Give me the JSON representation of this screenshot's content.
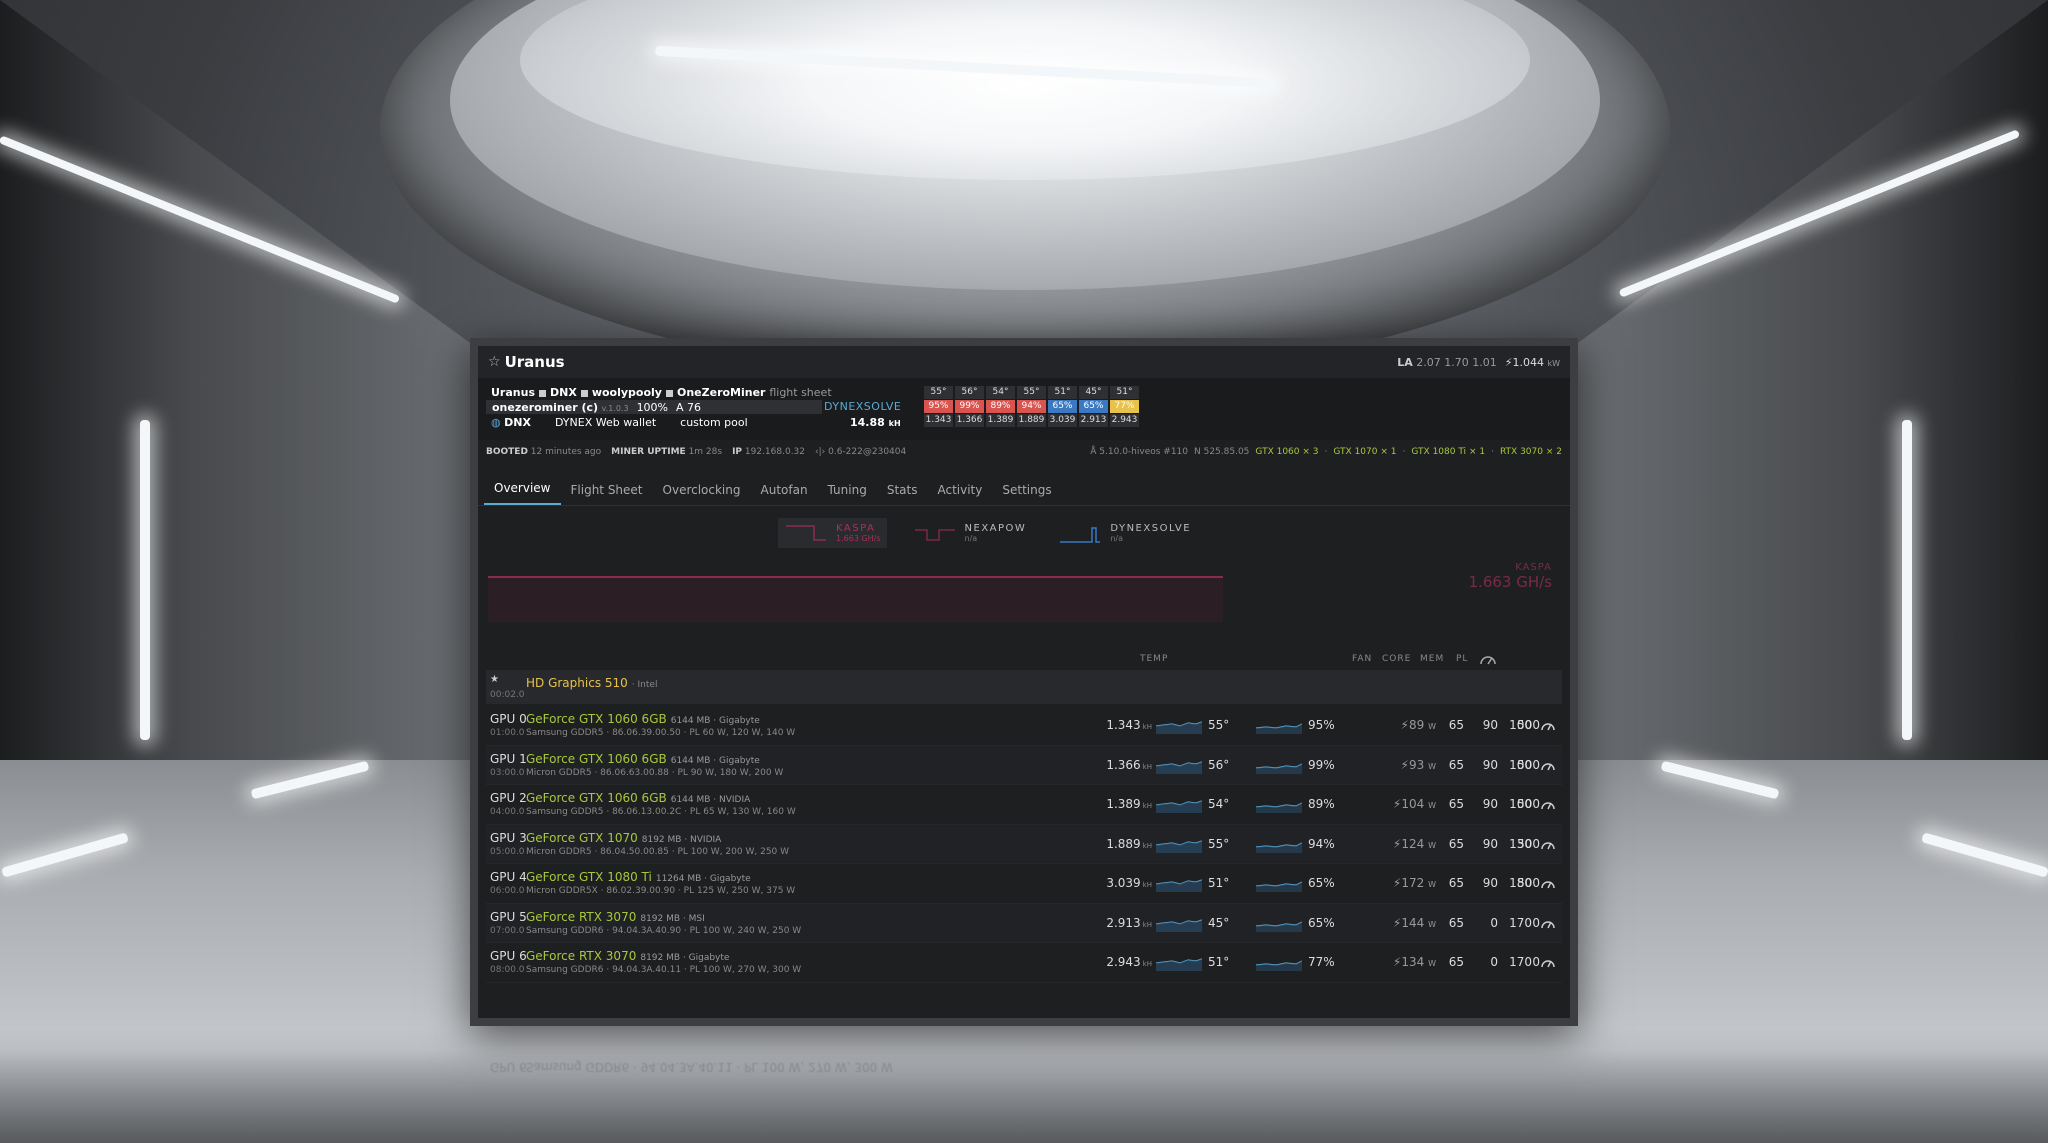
{
  "rig": {
    "name": "Uranus",
    "la_label": "LA",
    "la_values": "2.07 1.70 1.01",
    "power": "1.044",
    "power_unit": "kW"
  },
  "flight_sheet": {
    "parts": [
      "Uranus",
      "DNX",
      "woolypooly",
      "OneZeroMiner"
    ],
    "suffix": "flight sheet"
  },
  "miner": {
    "name": "onezerominer (c)",
    "version": "v.1.0.3",
    "accept": "100%",
    "shares": "A 76",
    "algo": "DYNEXSOLVE"
  },
  "coin": {
    "ticker": "DNX",
    "wallet": "DYNEX Web wallet",
    "pool": "custom pool",
    "hashrate": "14.88",
    "hash_unit": "kH"
  },
  "gpu_summary": [
    {
      "temp": "55°",
      "fan": "95%",
      "hash": "1.343",
      "color": "#d9534f"
    },
    {
      "temp": "56°",
      "fan": "99%",
      "hash": "1.366",
      "color": "#d9534f"
    },
    {
      "temp": "54°",
      "fan": "89%",
      "hash": "1.389",
      "color": "#d9534f"
    },
    {
      "temp": "55°",
      "fan": "94%",
      "hash": "1.889",
      "color": "#d9534f"
    },
    {
      "temp": "51°",
      "fan": "65%",
      "hash": "3.039",
      "color": "#3a78c2"
    },
    {
      "temp": "45°",
      "fan": "65%",
      "hash": "2.913",
      "color": "#3a78c2"
    },
    {
      "temp": "51°",
      "fan": "77%",
      "hash": "2.943",
      "color": "#e8c24a"
    }
  ],
  "boot": {
    "booted_label": "BOOTED",
    "booted_value": "12 minutes ago",
    "uptime_label": "MINER UPTIME",
    "uptime_value": "1m 28s",
    "ip_label": "IP",
    "ip_value": "192.168.0.32",
    "version": "0.6-222@230404",
    "kernel": "5.10.0-hiveos #110",
    "driver": "N 525.85.05",
    "gpus": [
      {
        "model": "GTX 1060",
        "count": "× 3"
      },
      {
        "model": "GTX 1070",
        "count": "× 1"
      },
      {
        "model": "GTX 1080 Ti",
        "count": "× 1"
      },
      {
        "model": "RTX 3070",
        "count": "× 2"
      }
    ]
  },
  "tabs": [
    "Overview",
    "Flight Sheet",
    "Overclocking",
    "Autofan",
    "Tuning",
    "Stats",
    "Activity",
    "Settings"
  ],
  "algos": [
    {
      "name": "KASPA",
      "value": "1.663 GH/s",
      "active": true
    },
    {
      "name": "NEXAPOW",
      "value": "n/a",
      "active": false
    },
    {
      "name": "DYNEXSOLVE",
      "value": "n/a",
      "active": false
    }
  ],
  "side_label": {
    "name": "KASPA",
    "value": "1.663 GH/s"
  },
  "headers": {
    "temp": "TEMP",
    "fan": "FAN",
    "core": "CORE",
    "mem": "MEM",
    "pl": "PL"
  },
  "igpu": {
    "star": "★",
    "bus": "00:02.0",
    "model": "HD Graphics 510",
    "vendor": "· Intel"
  },
  "gpus": [
    {
      "id": "GPU 0",
      "bus": "01:00.0",
      "model": "GeForce GTX 1060 6GB",
      "mem": "6144 MB · Gigabyte",
      "desc": "Samsung GDDR5 · 86.06.39.00.50 · PL 60 W, 120 W, 140 W",
      "hash": "1.343",
      "hash_unit": "kH",
      "temp": "55°",
      "fanp": "95%",
      "power": "89",
      "fan": "65",
      "core": "90",
      "memc": "500",
      "pl": "100"
    },
    {
      "id": "GPU 1",
      "bus": "03:00.0",
      "model": "GeForce GTX 1060 6GB",
      "mem": "6144 MB · Gigabyte",
      "desc": "Micron GDDR5 · 86.06.63.00.88 · PL 90 W, 180 W, 200 W",
      "hash": "1.366",
      "hash_unit": "kH",
      "temp": "56°",
      "fanp": "99%",
      "power": "93",
      "fan": "65",
      "core": "90",
      "memc": "500",
      "pl": "100"
    },
    {
      "id": "GPU 2",
      "bus": "04:00.0",
      "model": "GeForce GTX 1060 6GB",
      "mem": "6144 MB · NVIDIA",
      "desc": "Samsung GDDR5 · 86.06.13.00.2C · PL 65 W, 130 W, 160 W",
      "hash": "1.389",
      "hash_unit": "kH",
      "temp": "54°",
      "fanp": "89%",
      "power": "104",
      "fan": "65",
      "core": "90",
      "memc": "500",
      "pl": "100"
    },
    {
      "id": "GPU 3",
      "bus": "05:00.0",
      "model": "GeForce GTX 1070",
      "mem": "8192 MB · NVIDIA",
      "desc": "Micron GDDR5 · 86.04.50.00.85 · PL 100 W, 200 W, 250 W",
      "hash": "1.889",
      "hash_unit": "kH",
      "temp": "55°",
      "fanp": "94%",
      "power": "124",
      "fan": "65",
      "core": "90",
      "memc": "500",
      "pl": "130"
    },
    {
      "id": "GPU 4",
      "bus": "06:00.0",
      "model": "GeForce GTX 1080 Ti",
      "mem": "11264 MB · Gigabyte",
      "desc": "Micron GDDR5X · 86.02.39.00.90 · PL 125 W, 250 W, 375 W",
      "hash": "3.039",
      "hash_unit": "kH",
      "temp": "51°",
      "fanp": "65%",
      "power": "172",
      "fan": "65",
      "core": "90",
      "memc": "500",
      "pl": "180"
    },
    {
      "id": "GPU 5",
      "bus": "07:00.0",
      "model": "GeForce RTX 3070",
      "mem": "8192 MB · MSI",
      "desc": "Samsung GDDR6 · 94.04.3A.40.90 · PL 100 W, 240 W, 250 W",
      "hash": "2.913",
      "hash_unit": "kH",
      "temp": "45°",
      "fanp": "65%",
      "power": "144",
      "fan": "65",
      "core": "0",
      "memc": "0",
      "pl": "170"
    },
    {
      "id": "GPU 6",
      "bus": "08:00.0",
      "model": "GeForce RTX 3070",
      "mem": "8192 MB · Gigabyte",
      "desc": "Samsung GDDR6 · 94.04.3A.40.11 · PL 100 W, 270 W, 300 W",
      "hash": "2.943",
      "hash_unit": "kH",
      "temp": "51°",
      "fanp": "77%",
      "power": "134",
      "fan": "65",
      "core": "0",
      "memc": "0",
      "pl": "170"
    }
  ],
  "power_unit": "W"
}
